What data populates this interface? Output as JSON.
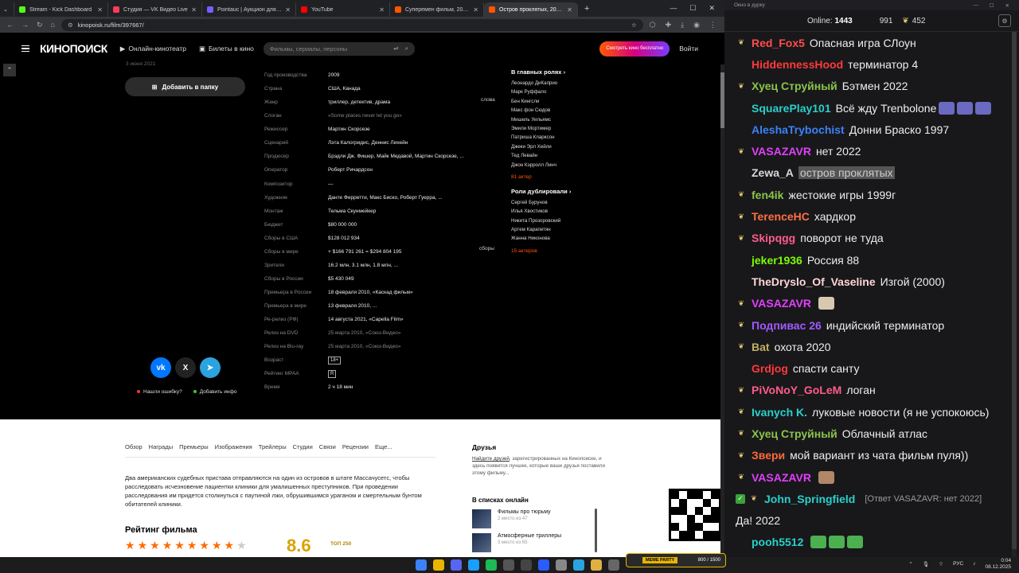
{
  "browser": {
    "tabs": [
      {
        "label": "Stream - Kick Dashboard",
        "color": "#53fc18"
      },
      {
        "label": "Студия — VK Видео Live",
        "color": "#ff3b5c"
      },
      {
        "label": "Pointauc | Аукцион для стрима",
        "color": "#7b5cff"
      },
      {
        "label": "YouTube",
        "color": "#ff0000"
      },
      {
        "label": "Суперемен фильм, 2025, дата в",
        "color": "#ff5500"
      },
      {
        "label": "Остров проклятых, 2009 — сп",
        "color": "#ff5500"
      }
    ],
    "new_tab": "+",
    "url": "kinopoisk.ru/film/397667/"
  },
  "kp": {
    "logo": "КИНОПОИСК",
    "online_cinema": "Онлайн-кинотеатр",
    "tickets": "Билеты в кино",
    "search_placeholder": "Фильмы, сериалы, персоны",
    "promo": "Смотреть кино бесплатно",
    "login": "Войти",
    "release_line": "3 июня 2021",
    "add_folder": "Добавить в папку",
    "facts": [
      {
        "k": "Год производства",
        "v": "2009"
      },
      {
        "k": "Страна",
        "v": "США, Канада"
      },
      {
        "k": "Жанр",
        "v": "триллер, детектив, драма"
      },
      {
        "k": "Слоган",
        "v": "«Some places never let you go»",
        "dim": true
      },
      {
        "k": "Режиссер",
        "v": "Мартин Скорсезе"
      },
      {
        "k": "Сценарий",
        "v": "Лэта Калогридис, Деннис Лихейн"
      },
      {
        "k": "Продюсер",
        "v": "Брэдли Дж. Фишер, Майк Медавой, Мартин Скорсезе, ..."
      },
      {
        "k": "Оператор",
        "v": "Роберт Ричардсон"
      },
      {
        "k": "Композитор",
        "v": "—"
      },
      {
        "k": "Художник",
        "v": "Данте Ферретти, Макс Биско, Роберт Гуерра, ..."
      },
      {
        "k": "Монтаж",
        "v": "Тельма Скунмейкер"
      },
      {
        "k": "Бюджет",
        "v": "$80 000 000"
      },
      {
        "k": "Сборы в США",
        "v": "$128 012 934"
      },
      {
        "k": "Сборы в мире",
        "v": "+ $166 791 261 = $294 804 195"
      },
      {
        "k": "Зрители",
        "v": "16.2 млн,   3.1 млн,   1.8 млн, ..."
      },
      {
        "k": "Сборы в России",
        "v": "$5 430 049"
      },
      {
        "k": "Премьера в России",
        "v": "18 февраля 2010, «Каскад фильм»"
      },
      {
        "k": "Премьера в мире",
        "v": "13 февраля 2010, ..."
      },
      {
        "k": "Ре-релиз (РФ)",
        "v": "14 августа 2021, «Capella Film»"
      },
      {
        "k": "Релиз на DVD",
        "v": "25 марта 2010, «Союз-Видео»",
        "dim": true
      },
      {
        "k": "Релиз на Blu-ray",
        "v": "25 марта 2010, «Союз-Видео»",
        "dim": true
      },
      {
        "k": "Возраст",
        "v": "18+",
        "badge": true
      },
      {
        "k": "Рейтинг MPAA",
        "v": "R",
        "badge": true
      },
      {
        "k": "Время",
        "v": "2 ч 18 мин"
      }
    ],
    "side_caption_1": "слова",
    "side_caption_2": "сборы",
    "cast_title": "В главных ролях",
    "cast": [
      "Леонардо ДиКаприо",
      "Марк Руффало",
      "Бен Кингсли",
      "Макс фон Сюдов",
      "Мишель Уильямс",
      "Эмили Мортимер",
      "Патриша Кларксон",
      "Джеки Эрл Хейли",
      "Тед Левайн",
      "Джон Кэрролл Линч"
    ],
    "cast_more": "81 актер",
    "dub_title": "Роли дублировали",
    "dub": [
      "Сергей Бурунов",
      "Илья Хвостиков",
      "Никита Прозоровский",
      "Артем Карапетян",
      "Жанна Никонова"
    ],
    "dub_more": "15 актеров",
    "error_link": "Нашли ошибку?",
    "add_info": "Добавить инфо",
    "subnav": [
      "Обзор",
      "Награды",
      "Премьеры",
      "Изображения",
      "Трейлеры",
      "Студии",
      "Связи",
      "Рецензии",
      "Еще..."
    ],
    "synopsis": "Два американских судебных пристава отправляются на один из островов в штате Массачусетс, чтобы расследовать исчезновение пациентки клиники для умалишенных преступников. При проведении расследования им придется столкнуться с паутиной лжи, обрушившимся ураганом и смертельным бунтом обитателей клиники.",
    "rating_title": "Рейтинг фильма",
    "rating_value": "8.6",
    "top250": "ТОП 250",
    "friends_title": "Друзья",
    "friends_link": "Найдите друзей",
    "friends_text": ", зарегистрированных на Кинопоиске, и здесь появится лучшее, которые ваши друзья поставили этому фильму...",
    "lists_title": "В списках онлайн",
    "lists": [
      {
        "t": "Фильмы про тюрьму",
        "s": "2 место из 47"
      },
      {
        "t": "Атмосферные триллеры",
        "s": "3 место из 65"
      }
    ]
  },
  "chat": {
    "window_title": "Окно в дурку",
    "online_label": "Online:",
    "online_count": "1443",
    "count1": "991",
    "count2": "452",
    "messages": [
      {
        "u": "Red_Fox5",
        "c": "#ff4d4d",
        "t": "Опасная игра СЛоун",
        "b": true
      },
      {
        "u": "HiddennessHood",
        "c": "#ff3a3a",
        "t": "терминатор 4",
        "b": false
      },
      {
        "u": "Хуец Струйный",
        "c": "#8bc34a",
        "t": "Бэтмен 2022",
        "b": true
      },
      {
        "u": "SquarePlay101",
        "c": "#2ad0c9",
        "t": "Всё жду Trenbolone",
        "b": false,
        "emo": "#6a6ac0"
      },
      {
        "u": "AleshaTrybochist",
        "c": "#3b82f6",
        "t": "Донни Браско 1997",
        "b": false
      },
      {
        "u": "VASAZAVR",
        "c": "#e040fb",
        "t": "нет 2022",
        "b": true
      },
      {
        "u": "Zewa_A",
        "c": "#d8d8d8",
        "t": "остров проклятых",
        "b": false,
        "hl": true
      },
      {
        "u": "fen4ik",
        "c": "#8bc34a",
        "t": "жестокие игры 1999г",
        "b": true
      },
      {
        "u": "TerenceHC",
        "c": "#ff7043",
        "t": "хардкор",
        "b": true
      },
      {
        "u": "Skipqgg",
        "c": "#ff5c8a",
        "t": "поворот не туда",
        "b": true
      },
      {
        "u": "jeker1936",
        "c": "#7cfc00",
        "t": "Россия 88",
        "b": false
      },
      {
        "u": "TheDryslo_Of_Vaseline",
        "c": "#ffd6d6",
        "t": "Изгой (2000)",
        "b": false
      },
      {
        "u": "VASAZAVR",
        "c": "#e040fb",
        "t": "",
        "b": true,
        "emo": "#d8c8b0"
      },
      {
        "u": "Подпивас 26",
        "c": "#a259ff",
        "t": "индийский терминатор",
        "b": true
      },
      {
        "u": "Bat",
        "c": "#c0b060",
        "t": "охота 2020",
        "b": true
      },
      {
        "u": "Grdjog",
        "c": "#ff3a3a",
        "t": "спасти санту",
        "b": false
      },
      {
        "u": "PiVoNoY_GoLeM",
        "c": "#ff5c8a",
        "t": "логан",
        "b": true
      },
      {
        "u": "Ivanych K.",
        "c": "#2ad0c9",
        "t": "луковые новости (я не успокоюсь)",
        "b": true
      },
      {
        "u": "Хуец Струйный",
        "c": "#8bc34a",
        "t": "Облачный атлас",
        "b": true
      },
      {
        "u": "Звери",
        "c": "#ff6a3a",
        "t": "мой вариант из чата фильм пуля))",
        "b": true
      },
      {
        "u": "VASAZAVR",
        "c": "#e040fb",
        "t": "",
        "b": true,
        "emo": "#b08868"
      }
    ],
    "reply_user": "John_Springfield",
    "reply_user_color": "#2ad0c9",
    "reply_ref": "[Ответ VASAZAVR: нет 2022]",
    "reply_text": "Да! 2022",
    "last_user": "pooh5512",
    "last_user_color": "#2ad0c9"
  },
  "taskbar": {
    "meme_label": "MEME PARTY",
    "meme_count": "800 / 1500",
    "lang": "РУС",
    "time": "0:04",
    "date": "08.12.2025"
  }
}
